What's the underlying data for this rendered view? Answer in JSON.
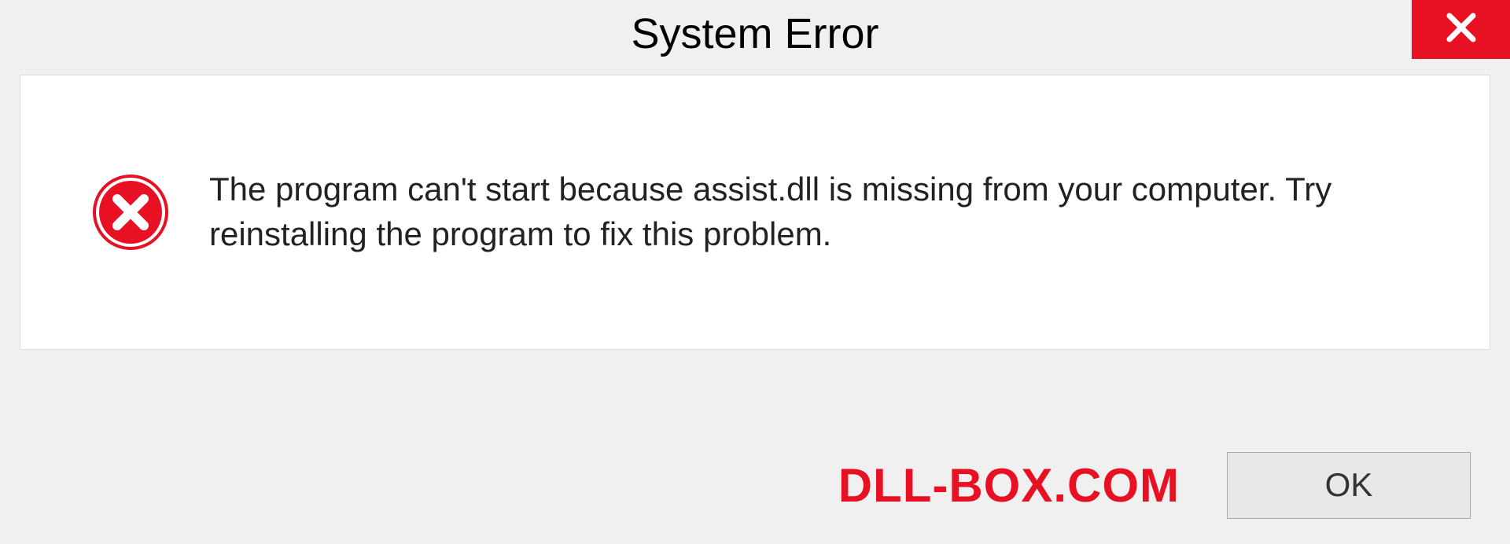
{
  "dialog": {
    "title": "System Error",
    "message": "The program can't start because assist.dll is missing from your computer. Try reinstalling the program to fix this problem.",
    "ok_label": "OK",
    "watermark": "DLL-BOX.COM"
  }
}
